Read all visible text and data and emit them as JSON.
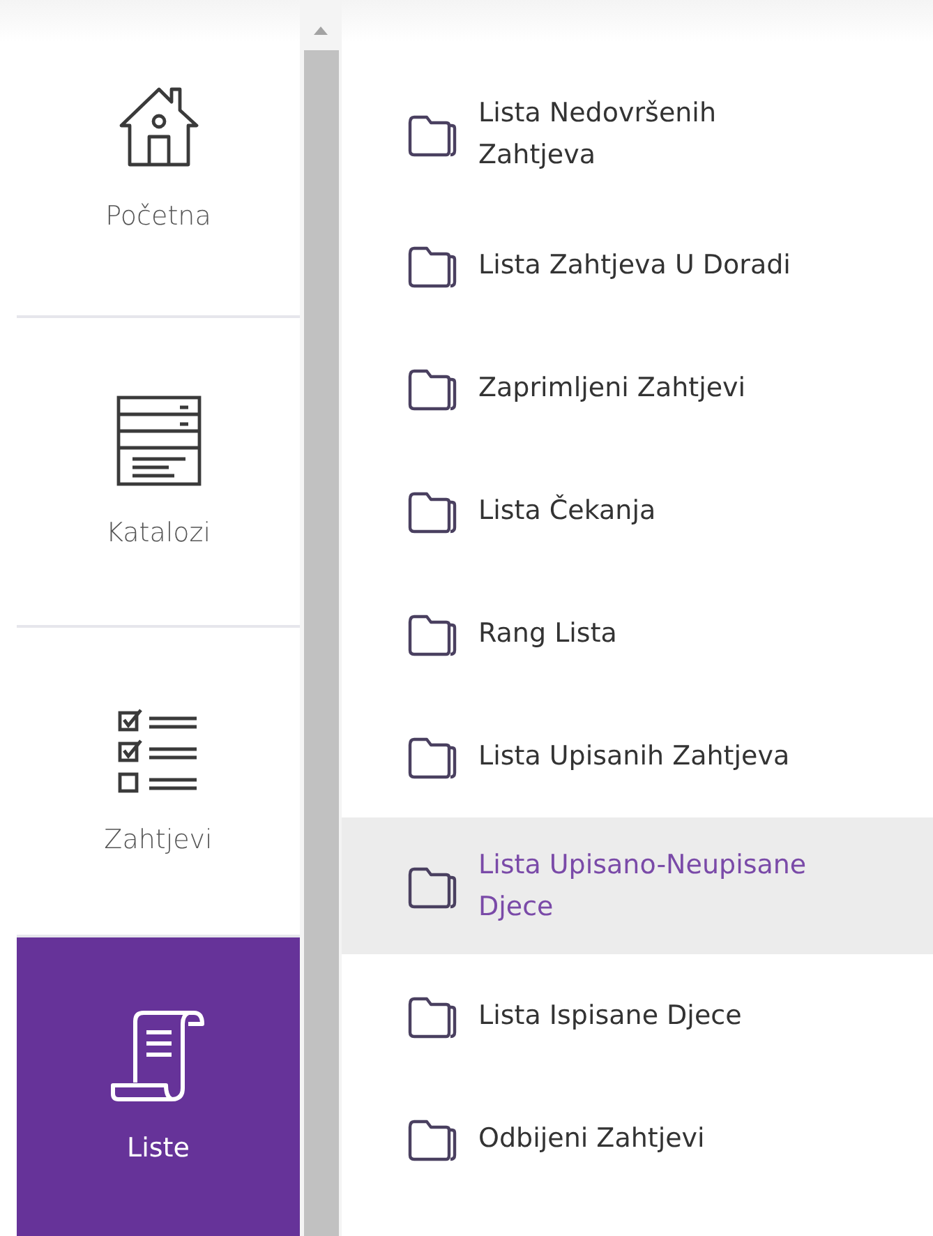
{
  "nav": [
    {
      "label": "Početna",
      "kind": "home",
      "selected": false
    },
    {
      "label": "Katalozi",
      "kind": "catalog",
      "selected": false
    },
    {
      "label": "Zahtjevi",
      "kind": "checklist",
      "selected": false
    },
    {
      "label": "Liste",
      "kind": "scroll",
      "selected": true
    }
  ],
  "lists": [
    {
      "label": "Lista Nedovršenih Zahtjeva",
      "selected": false
    },
    {
      "label": "Lista Zahtjeva U Doradi",
      "selected": false
    },
    {
      "label": "Zaprimljeni Zahtjevi",
      "selected": false
    },
    {
      "label": "Lista Čekanja",
      "selected": false
    },
    {
      "label": "Rang Lista",
      "selected": false
    },
    {
      "label": "Lista Upisanih Zahtjeva",
      "selected": false
    },
    {
      "label": "Lista Upisano-Neupisane Djece",
      "selected": true
    },
    {
      "label": "Lista Ispisane Djece",
      "selected": false
    },
    {
      "label": "Odbijeni Zahtjevi",
      "selected": false
    }
  ]
}
